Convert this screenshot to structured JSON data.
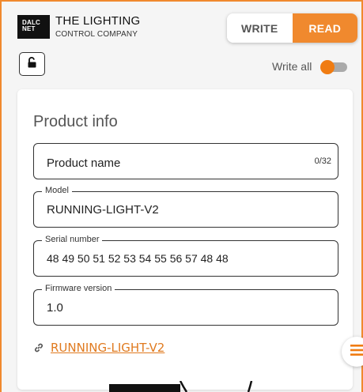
{
  "brand": {
    "logo_text_top": "DALC",
    "logo_text_bottom": "NET",
    "line1": "THE LIGHTING",
    "line2": "CONTROL COMPANY"
  },
  "mode_switch": {
    "write_label": "WRITE",
    "read_label": "READ",
    "selected": "READ"
  },
  "toolbar": {
    "lock_icon": "unlock-icon",
    "write_all_label": "Write all",
    "write_all_on": false
  },
  "product_info": {
    "title": "Product info",
    "product_name": {
      "placeholder": "Product name",
      "value": "",
      "counter": "0/32"
    },
    "model": {
      "label": "Model",
      "value": "RUNNING-LIGHT-V2"
    },
    "serial_number": {
      "label": "Serial number",
      "value": "48 49 50 51 52 53 54 55 56 57 48 48"
    },
    "firmware_version": {
      "label": "Firmware version",
      "value": "1.0"
    },
    "link": {
      "icon": "link-icon",
      "text": "RUNNING-LIGHT-V2"
    }
  },
  "fab": {
    "icon": "menu-icon"
  },
  "colors": {
    "accent": "#f0892e",
    "link": "#e07a1f",
    "background": "#f5f5f5"
  }
}
